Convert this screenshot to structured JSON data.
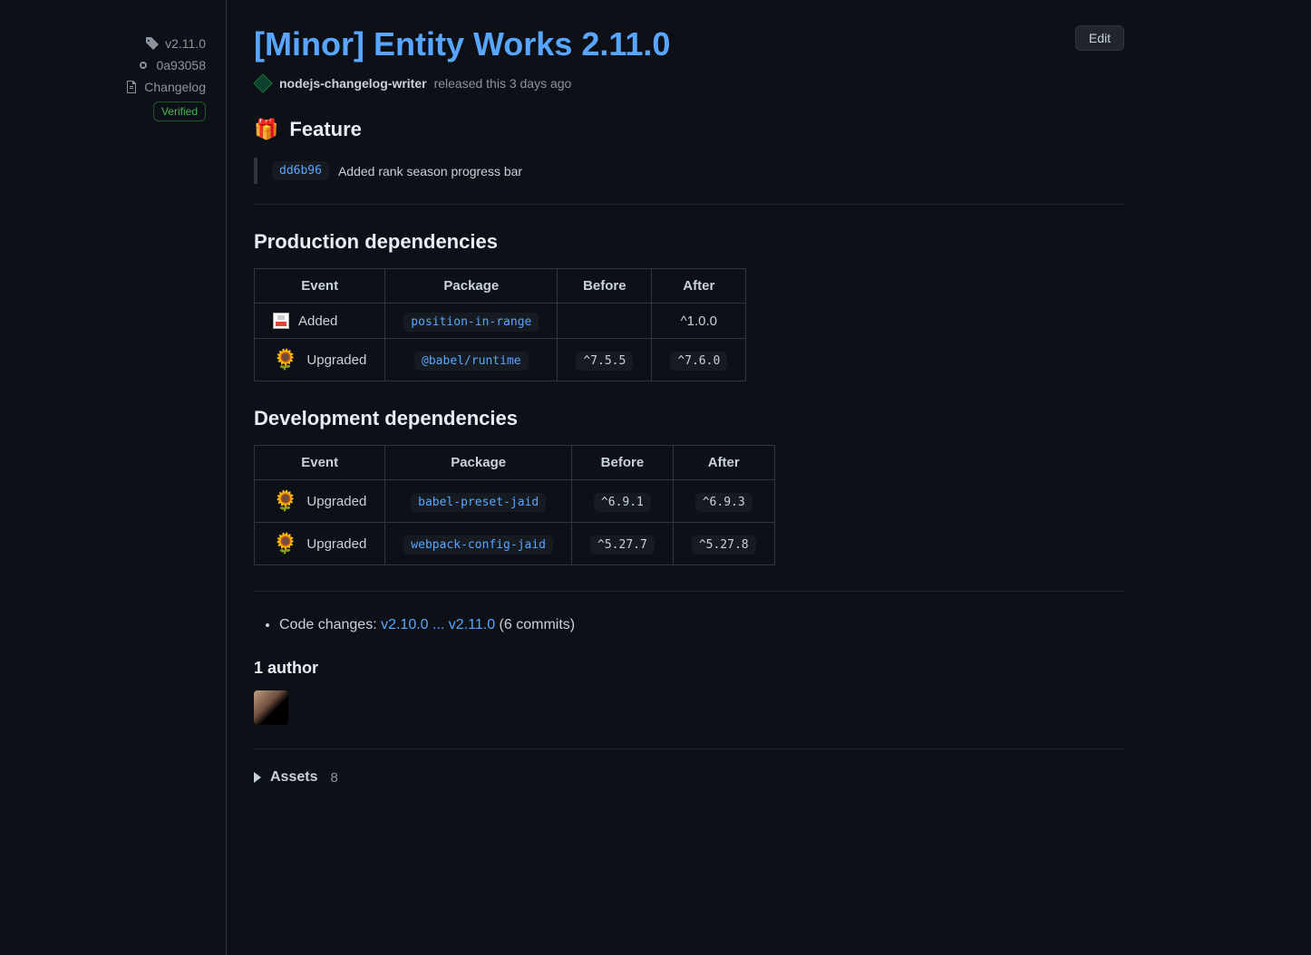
{
  "sidebar": {
    "tag": "v2.11.0",
    "commit": "0a93058",
    "changelog": "Changelog",
    "verified": "Verified"
  },
  "header": {
    "title": "[Minor] Entity Works 2.11.0",
    "edit": "Edit",
    "author": "nodejs-changelog-writer",
    "released_text": "released this 3 days ago"
  },
  "feature": {
    "heading": "Feature",
    "commit": "dd6b96",
    "desc": "Added rank season progress bar"
  },
  "prod_deps": {
    "heading": "Production dependencies",
    "cols": {
      "event": "Event",
      "package": "Package",
      "before": "Before",
      "after": "After"
    },
    "rows": [
      {
        "icon": "save",
        "event": "Added",
        "package": "position-in-range",
        "before": "",
        "after": "^1.0.0",
        "after_code": false
      },
      {
        "icon": "flower",
        "event": "Upgraded",
        "package": "@babel/runtime",
        "before": "^7.5.5",
        "after": "^7.6.0",
        "after_code": true
      }
    ]
  },
  "dev_deps": {
    "heading": "Development dependencies",
    "cols": {
      "event": "Event",
      "package": "Package",
      "before": "Before",
      "after": "After"
    },
    "rows": [
      {
        "icon": "flower",
        "event": "Upgraded",
        "package": "babel-preset-jaid",
        "before": "^6.9.1",
        "after": "^6.9.3"
      },
      {
        "icon": "flower",
        "event": "Upgraded",
        "package": "webpack-config-jaid",
        "before": "^5.27.7",
        "after": "^5.27.8"
      }
    ]
  },
  "changes": {
    "prefix": "Code changes: ",
    "link": "v2.10.0 ... v2.11.0",
    "suffix": " (6 commits)"
  },
  "author_section": {
    "heading": "1 author"
  },
  "assets": {
    "label": "Assets",
    "count": "8"
  }
}
